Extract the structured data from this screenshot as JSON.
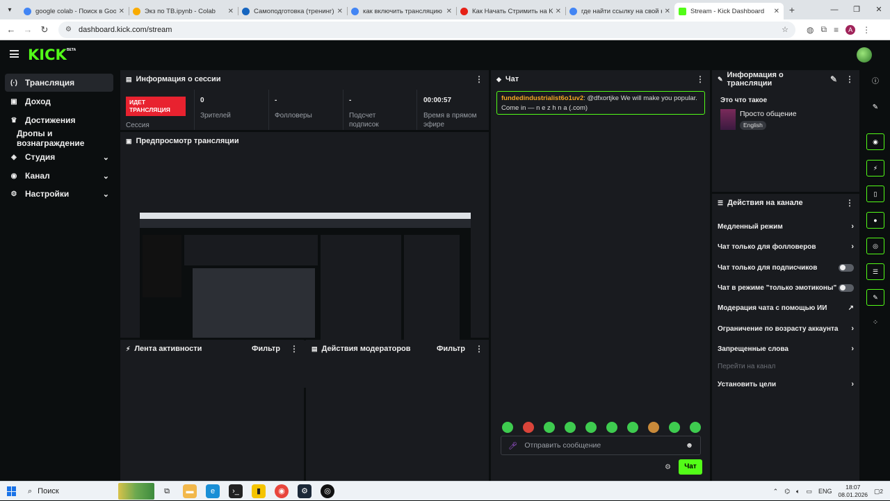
{
  "browser": {
    "tabs": [
      {
        "title": "google colab - Поиск в Google",
        "color": "#4285f4"
      },
      {
        "title": "Экз по ТВ.ipynb - Colab",
        "color": "#f9ab00"
      },
      {
        "title": "Самоподготовка (тренинг) к э",
        "color": "#1565c0"
      },
      {
        "title": "как включить трансляцию на",
        "color": "#4285f4"
      },
      {
        "title": "Как Начать Стримить на Kick",
        "color": "#e62117"
      },
      {
        "title": "где найти ссылку на свой кан",
        "color": "#4285f4"
      },
      {
        "title": "Stream - Kick Dashboard",
        "color": "#53fc18"
      }
    ],
    "url": "dashboard.kick.com/stream",
    "profile_letter": "A"
  },
  "header": {
    "logo": "KICK",
    "beta": "BETA"
  },
  "sidebar": {
    "items": [
      {
        "label": "Трансляция",
        "icon": "broadcast-icon"
      },
      {
        "label": "Доход",
        "icon": "wallet-icon"
      },
      {
        "label": "Достижения",
        "icon": "trophy-icon"
      },
      {
        "label": "Дропы и вознаграждение"
      },
      {
        "label": "Студия",
        "icon": "studio-icon"
      },
      {
        "label": "Канал",
        "icon": "channel-icon"
      },
      {
        "label": "Настройки",
        "icon": "gear-icon"
      }
    ]
  },
  "session": {
    "title": "Информация о сессии",
    "live_badge": "ИДЕТ ТРАНСЛЯЦИЯ",
    "session_label": "Сессия",
    "stats": [
      {
        "value": "0",
        "label": "Зрителей"
      },
      {
        "value": "-",
        "label": "Фолловеры"
      },
      {
        "value": "-",
        "label": "Подсчет подписок"
      },
      {
        "value": "00:00:57",
        "label": "Время в прямом эфире"
      }
    ]
  },
  "preview": {
    "title": "Предпросмотр трансляции"
  },
  "activity": {
    "title": "Лента активности",
    "filter": "Фильтр"
  },
  "mods": {
    "title": "Действия модераторов",
    "filter": "Фильтр"
  },
  "chat": {
    "title": "Чат",
    "message_user": "fundedindustrialist6o1uv2",
    "message_text": ": @dfxortjke We will make you popular. Come in — n e z h n a (.com)",
    "input_placeholder": "Отправить сообщение",
    "send_label": "Чат"
  },
  "stream_info": {
    "title": "Информация о трансляции",
    "subtitle": "Это что такое",
    "stream_title": "Просто общение",
    "language": "English"
  },
  "channel_actions": {
    "title": "Действия на канале",
    "items": [
      {
        "label": "Медленный режим",
        "kind": "chevron"
      },
      {
        "label": "Чат только для фолловеров",
        "kind": "chevron"
      },
      {
        "label": "Чат только для подписчиков",
        "kind": "toggle"
      },
      {
        "label": "Чат в режиме \"только эмотиконы\"",
        "kind": "toggle"
      },
      {
        "label": "Модерация чата с помощью ИИ",
        "kind": "external"
      },
      {
        "label": "Ограничение по возрасту аккаунта",
        "kind": "chevron"
      },
      {
        "label": "Запрещенные слова",
        "kind": "chevron"
      },
      {
        "label": "Перейти на канал",
        "kind": "disabled"
      },
      {
        "label": "Установить цели",
        "kind": "chevron"
      }
    ]
  },
  "taskbar": {
    "search": "Поиск",
    "lang": "ENG",
    "time": "18:07",
    "date": "08.01.2026",
    "notif": "2"
  },
  "colors": {
    "accent": "#53fc18",
    "live": "#e8222f",
    "panel": "#191b1f",
    "bg": "#0b0e0f"
  }
}
